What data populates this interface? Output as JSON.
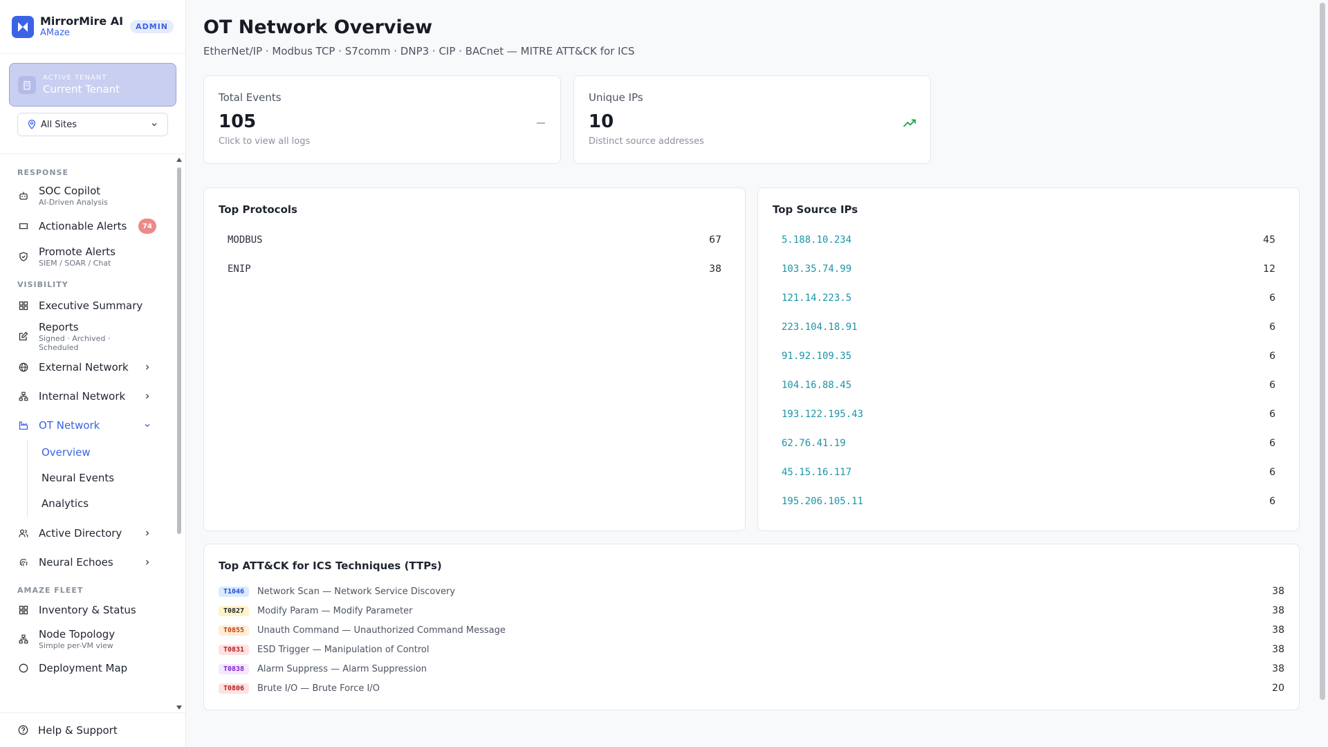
{
  "brand": {
    "name": "MirrorMire AI",
    "sub": "AMaze",
    "role_badge": "ADMIN"
  },
  "tenant": {
    "label": "ACTIVE TENANT",
    "value": "Current Tenant"
  },
  "site_filter": {
    "value": "All Sites"
  },
  "sidebar": {
    "sections": {
      "response": "RESPONSE",
      "visibility": "VISIBILITY",
      "fleet": "AMAZE FLEET"
    },
    "items": {
      "soc_copilot": {
        "label": "SOC Copilot",
        "sub": "AI-Driven Analysis"
      },
      "actionable_alerts": {
        "label": "Actionable Alerts",
        "badge": "74"
      },
      "promote_alerts": {
        "label": "Promote Alerts",
        "sub": "SIEM / SOAR / Chat"
      },
      "executive_summary": {
        "label": "Executive Summary"
      },
      "reports": {
        "label": "Reports",
        "sub": "Signed · Archived · Scheduled"
      },
      "external_network": {
        "label": "External Network"
      },
      "internal_network": {
        "label": "Internal Network"
      },
      "ot_network": {
        "label": "OT Network"
      },
      "ot_overview": {
        "label": "Overview"
      },
      "ot_neural_events": {
        "label": "Neural Events"
      },
      "ot_analytics": {
        "label": "Analytics"
      },
      "active_directory": {
        "label": "Active Directory"
      },
      "neural_echoes": {
        "label": "Neural Echoes"
      },
      "inventory_status": {
        "label": "Inventory & Status"
      },
      "node_topology": {
        "label": "Node Topology",
        "sub": "Simple per-VM view"
      },
      "deployment_map": {
        "label": "Deployment Map"
      }
    },
    "help": "Help & Support"
  },
  "page": {
    "title": "OT Network Overview",
    "subtitle": "EtherNet/IP · Modbus TCP · S7comm · DNP3 · CIP · BACnet — MITRE ATT&CK for ICS"
  },
  "stats": {
    "total_events": {
      "label": "Total Events",
      "value": "105",
      "hint": "Click to view all logs",
      "trend_icon": "dash-icon"
    },
    "unique_ips": {
      "label": "Unique IPs",
      "value": "10",
      "hint": "Distinct source addresses",
      "trend_icon": "trending-up-icon",
      "trend_color": "#16a34a"
    }
  },
  "top_protocols": {
    "title": "Top Protocols",
    "rows": [
      {
        "name": "MODBUS",
        "count": "67"
      },
      {
        "name": "ENIP",
        "count": "38"
      }
    ]
  },
  "top_source_ips": {
    "title": "Top Source IPs",
    "rows": [
      {
        "ip": "5.188.10.234",
        "count": "45"
      },
      {
        "ip": "103.35.74.99",
        "count": "12"
      },
      {
        "ip": "121.14.223.5",
        "count": "6"
      },
      {
        "ip": "223.104.18.91",
        "count": "6"
      },
      {
        "ip": "91.92.109.35",
        "count": "6"
      },
      {
        "ip": "104.16.88.45",
        "count": "6"
      },
      {
        "ip": "193.122.195.43",
        "count": "6"
      },
      {
        "ip": "62.76.41.19",
        "count": "6"
      },
      {
        "ip": "45.15.16.117",
        "count": "6"
      },
      {
        "ip": "195.206.105.11",
        "count": "6"
      }
    ]
  },
  "top_ttps": {
    "title": "Top ATT&CK for ICS Techniques (TTPs)",
    "rows": [
      {
        "id": "T1046",
        "name": "Network Scan — Network Service Discovery",
        "count": "38",
        "bg": "#dbeafe",
        "fg": "#1d4ed8"
      },
      {
        "id": "T0827",
        "name": "Modify Param — Modify Parameter",
        "count": "38",
        "bg": "#fef3c7",
        "fg": "#1f2430"
      },
      {
        "id": "T0855",
        "name": "Unauth Command — Unauthorized Command Message",
        "count": "38",
        "bg": "#ffedd5",
        "fg": "#c2410c"
      },
      {
        "id": "T0831",
        "name": "ESD Trigger — Manipulation of Control",
        "count": "38",
        "bg": "#fee2e2",
        "fg": "#b91c1c"
      },
      {
        "id": "T0838",
        "name": "Alarm Suppress — Alarm Suppression",
        "count": "38",
        "bg": "#f3e8ff",
        "fg": "#7e22ce"
      },
      {
        "id": "T0806",
        "name": "Brute I/O — Brute Force I/O",
        "count": "20",
        "bg": "#fee2e2",
        "fg": "#b91c1c"
      }
    ]
  },
  "colors": {
    "accent": "#3b63e6",
    "ip_link": "#1b95a8",
    "alert_badge": "#ec8a8a"
  }
}
